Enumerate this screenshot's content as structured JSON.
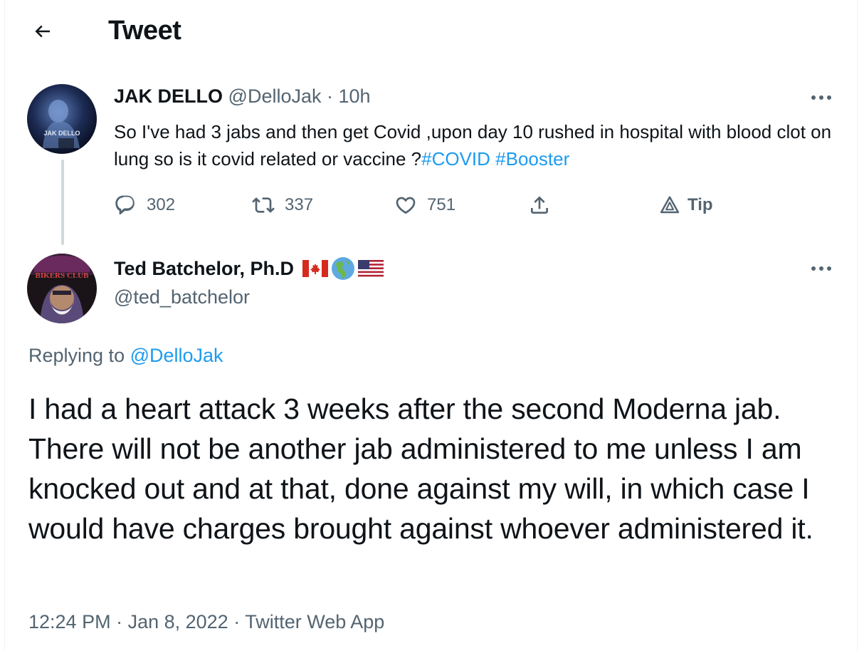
{
  "header": {
    "title": "Tweet"
  },
  "tweet1": {
    "display_name": "JAK DELLO",
    "handle": "@DelloJak",
    "separator": " · ",
    "time": "10h",
    "avatar_text": "JAK DELLO",
    "text": "So I've had 3 jabs and then get Covid ,upon day 10 rushed in hospital with blood clot on lung so is it covid related or vaccine ?",
    "hashtags": [
      "#COVID",
      "#Booster"
    ],
    "actions": {
      "replies": "302",
      "retweets": "337",
      "likes": "751",
      "tip_label": "Tip"
    }
  },
  "tweet2": {
    "display_name": "Ted Batchelor, Ph.D",
    "handle": "@ted_batchelor",
    "avatar_text": "BIKERS CLUB",
    "replying_prefix": "Replying to ",
    "replying_to": "@DelloJak",
    "text": "I had a heart attack 3 weeks after the second Moderna jab. There will not be another jab administered to me unless I am knocked out and at that, done against my will, in which case I would have charges brought against whoever administered it.",
    "meta": {
      "time": "12:24 PM",
      "separator": " · ",
      "date": "Jan 8, 2022",
      "source": "Twitter Web App"
    }
  },
  "colors": {
    "link": "#1d9bf0",
    "muted": "#536471",
    "text": "#0f1419",
    "thread_line": "#cfd9de"
  }
}
